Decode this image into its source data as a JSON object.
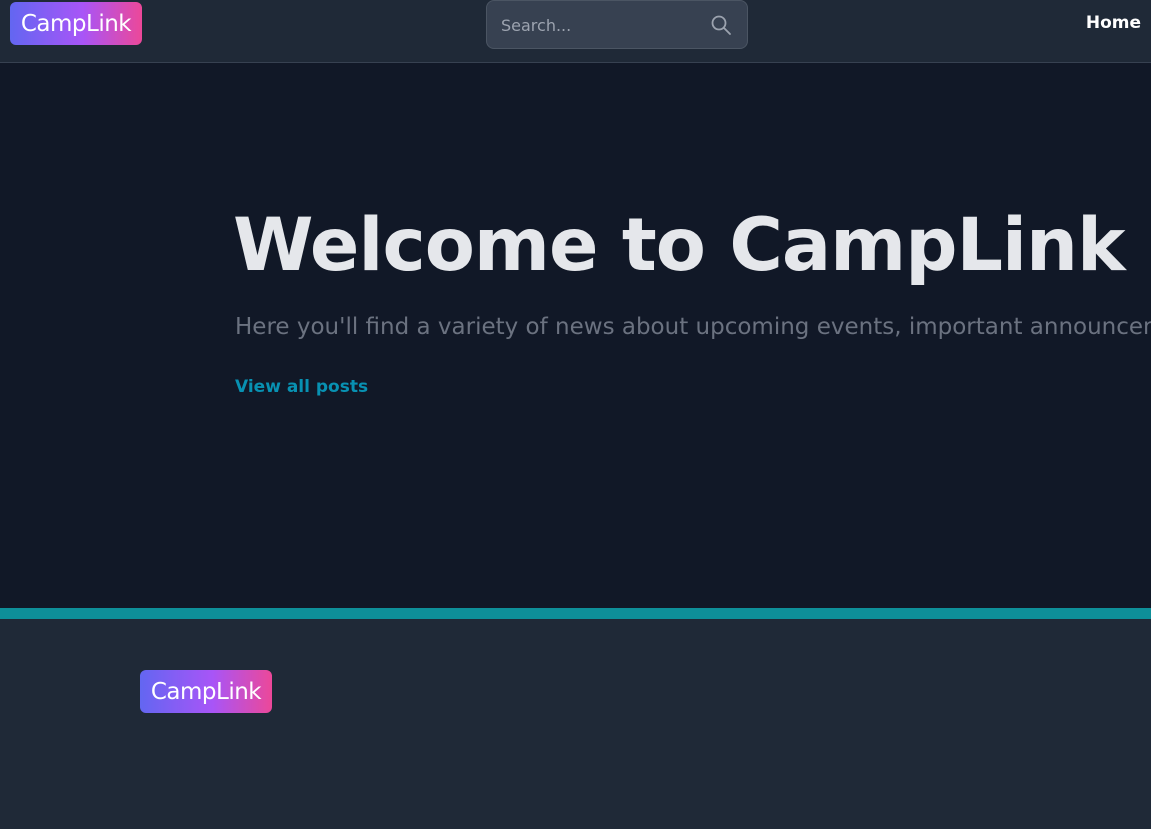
{
  "header": {
    "logo_text": "CampLink",
    "search": {
      "placeholder": "Search..."
    },
    "nav": {
      "home_label": "Home"
    }
  },
  "hero": {
    "title": "Welcome to CampLink",
    "subtitle": "Here you'll find a variety of news about upcoming events, important announcements",
    "link_label": "View all posts"
  },
  "footer": {
    "logo_text": "CampLink"
  },
  "colors": {
    "header_bg": "#1f2937",
    "hero_bg": "#111827",
    "footer_bg": "#1f2937",
    "accent": "#0e8f99",
    "link": "#0891b2",
    "logo_gradient_start": "#6366f1",
    "logo_gradient_end": "#ec4899"
  },
  "icons": {
    "search": "search-icon"
  }
}
